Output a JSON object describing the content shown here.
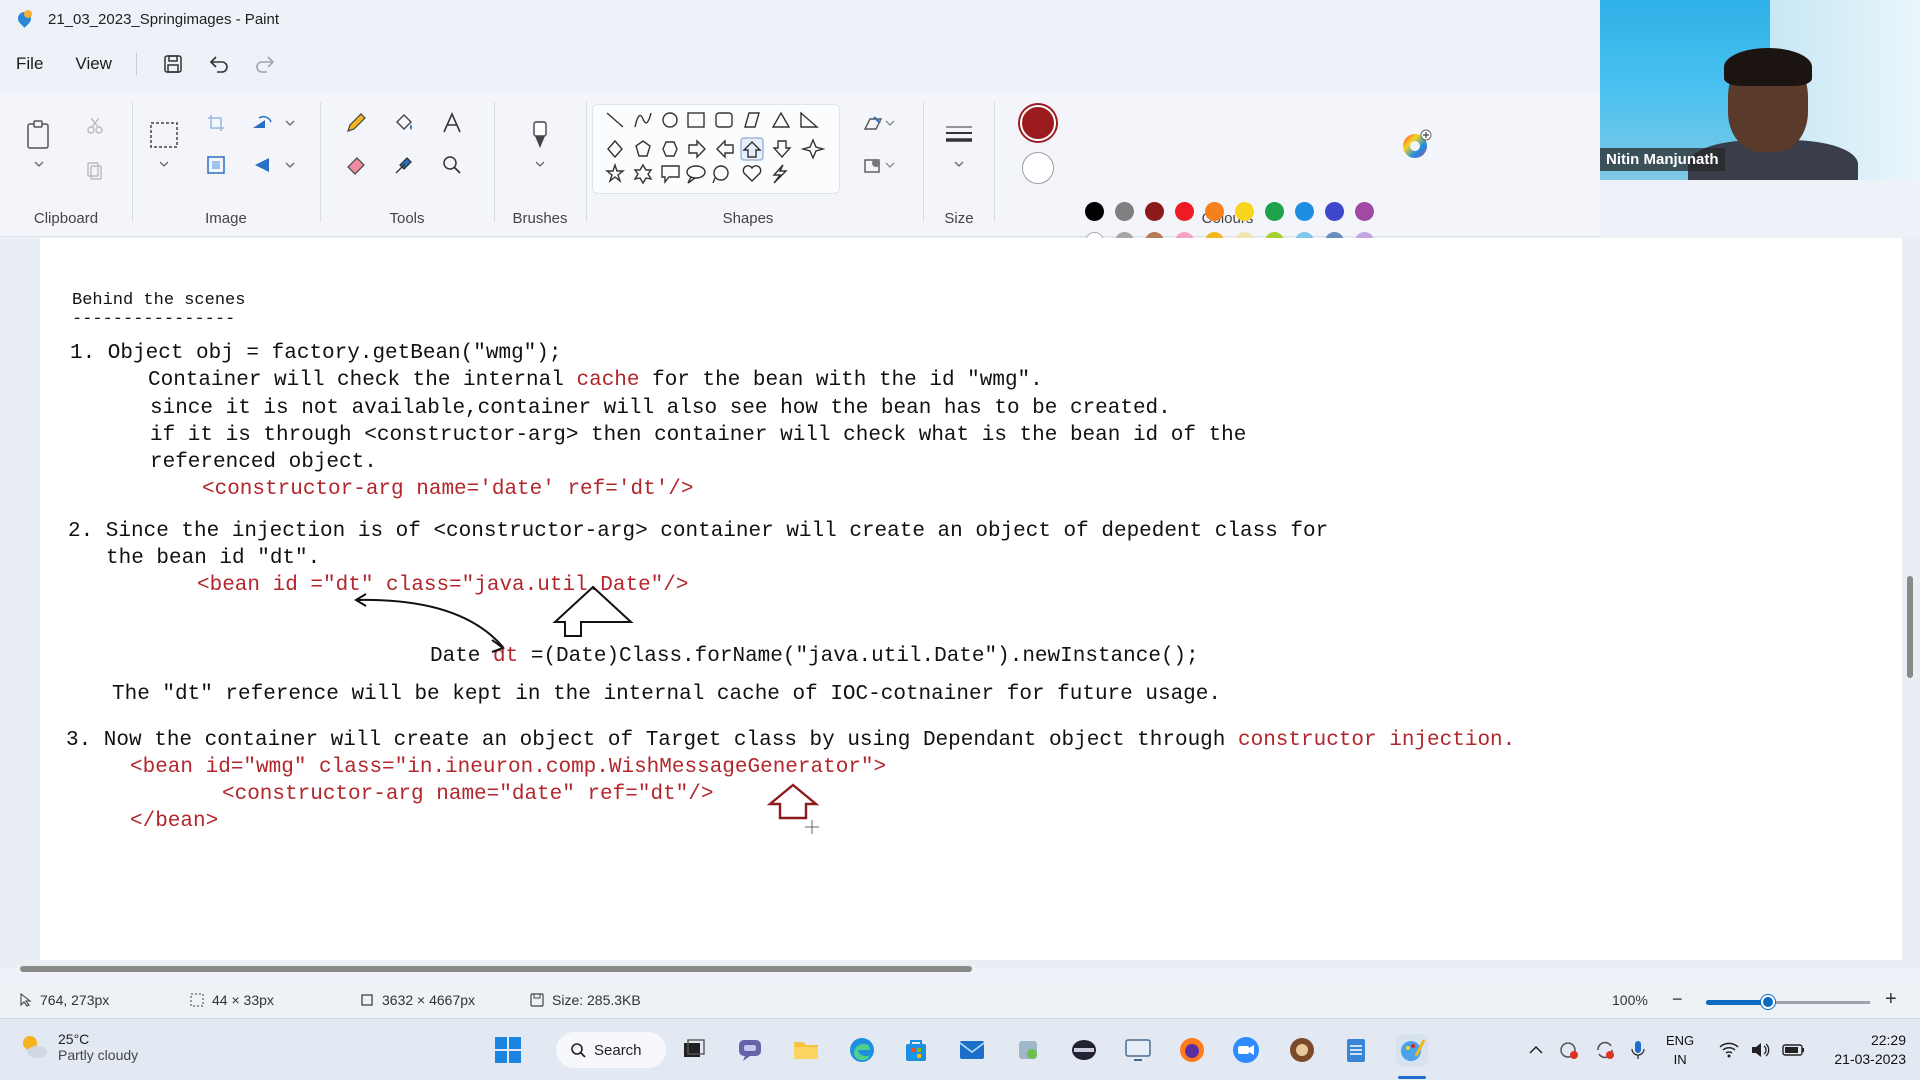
{
  "window": {
    "title": "21_03_2023_Springimages - Paint"
  },
  "menu": {
    "file": "File",
    "view": "View"
  },
  "ribbon": {
    "groups": {
      "clipboard": "Clipboard",
      "image": "Image",
      "tools": "Tools",
      "brushes": "Brushes",
      "shapes": "Shapes",
      "size": "Size",
      "colours": "Colours"
    },
    "current_colors": {
      "primary": "#9b1b1f",
      "secondary": "#ffffff"
    },
    "palette_row1": [
      "#000000",
      "#7f7f7f",
      "#8b1a1a",
      "#ed1c24",
      "#f7801e",
      "#f7d51d",
      "#1fa34a",
      "#1e8fe0",
      "#3f48cc",
      "#a249a4"
    ],
    "palette_row2": [
      "#ffffff",
      "#a6a6a6",
      "#b97a57",
      "#f4a3c0",
      "#f3b61f",
      "#efe4b0",
      "#a3d12c",
      "#7fc6e8",
      "#6c8ebf",
      "#c2a6dd"
    ]
  },
  "webcam": {
    "name": "Nitin Manjunath"
  },
  "canvas": {
    "heading": "Behind the scenes",
    "underline": "----------------",
    "s1_l1": "1. Object obj = factory.getBean(\"wmg\");",
    "s1_l2a": "Container will check the internal ",
    "s1_l2b": "cache",
    "s1_l2c": " for the bean with the id \"wmg\".",
    "s1_l3": "since it is not available,container will also see how the bean has to be created.",
    "s1_l4": "if it is through <constructor-arg> then container will check what is the bean id of the",
    "s1_l5": "referenced object.",
    "s1_l6": "<constructor-arg name='date' ref='dt'/>",
    "s2_l1": "2. Since the injection is of <constructor-arg> container will create an object of depedent class for",
    "s2_l2": "the bean id \"dt\".",
    "s2_l3": "<bean id =\"dt\" class=\"java.util.Date\"/>",
    "s2_l4a": "Date ",
    "s2_l4b": "dt",
    "s2_l4c": " =(Date)Class.forName(\"java.util.Date\").newInstance();",
    "s2_l5": "The \"dt\" reference will be kept in the internal cache of IOC-cotnainer for future usage.",
    "s3_l1a": "3. Now the container will create an object of Target class by using Dependant object through ",
    "s3_l1b": "constructor injection.",
    "s3_l2": "<bean id=\"wmg\" class=\"in.ineuron.comp.WishMessageGenerator\">",
    "s3_l3": "<constructor-arg name=\"date\" ref=\"dt\"/>",
    "s3_l4": "</bean>"
  },
  "status": {
    "cursor": "764, 273px",
    "selection": "44 × 33px",
    "canvas_size": "3632 × 4667px",
    "file_size": "Size: 285.3KB",
    "zoom": "100%",
    "zoom_fraction": 0.38
  },
  "taskbar": {
    "weather_temp": "25°C",
    "weather_desc": "Partly cloudy",
    "search": "Search",
    "lang1": "ENG",
    "lang2": "IN",
    "time": "22:29",
    "date": "21-03-2023"
  }
}
